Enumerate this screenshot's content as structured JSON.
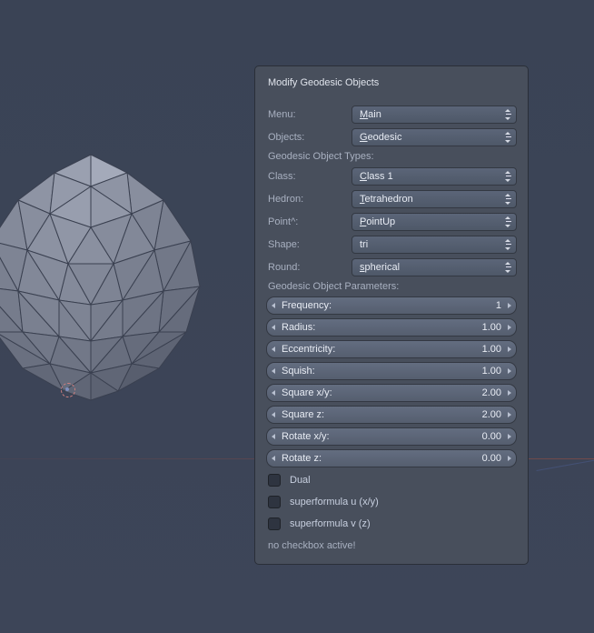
{
  "panel": {
    "title": "Modify Geodesic Objects",
    "dropdowns": {
      "menu": {
        "label": "Menu:",
        "value": "Main",
        "underline": 0
      },
      "objects": {
        "label": "Objects:",
        "value": "Geodesic",
        "underline": 0
      },
      "class": {
        "label": "Class:",
        "value": "Class 1",
        "underline": 0
      },
      "hedron": {
        "label": "Hedron:",
        "value": "Tetrahedron",
        "underline": 0
      },
      "point": {
        "label": "Point^:",
        "value": "PointUp",
        "underline": 0
      },
      "shape": {
        "label": "Shape:",
        "value": "tri",
        "underline": -1
      },
      "round": {
        "label": "Round:",
        "value": "spherical",
        "underline": 0
      }
    },
    "sections": {
      "types": "Geodesic Object Types:",
      "params": "Geodesic Object Parameters:"
    },
    "sliders": {
      "frequency": {
        "label": "Frequency:",
        "value": "1"
      },
      "radius": {
        "label": "Radius:",
        "value": "1.00"
      },
      "eccentricity": {
        "label": "Eccentricity:",
        "value": "1.00"
      },
      "squish": {
        "label": "Squish:",
        "value": "1.00"
      },
      "squarexy": {
        "label": "Square x/y:",
        "value": "2.00"
      },
      "squarez": {
        "label": "Square z:",
        "value": "2.00"
      },
      "rotatexy": {
        "label": "Rotate x/y:",
        "value": "0.00"
      },
      "rotatez": {
        "label": "Rotate z:",
        "value": "0.00"
      }
    },
    "checkboxes": {
      "dual": {
        "label": "Dual",
        "checked": false
      },
      "superu": {
        "label": "superformula u (x/y)",
        "checked": false
      },
      "superv": {
        "label": "superformula v (z)",
        "checked": false
      }
    },
    "status": "no checkbox active!"
  }
}
